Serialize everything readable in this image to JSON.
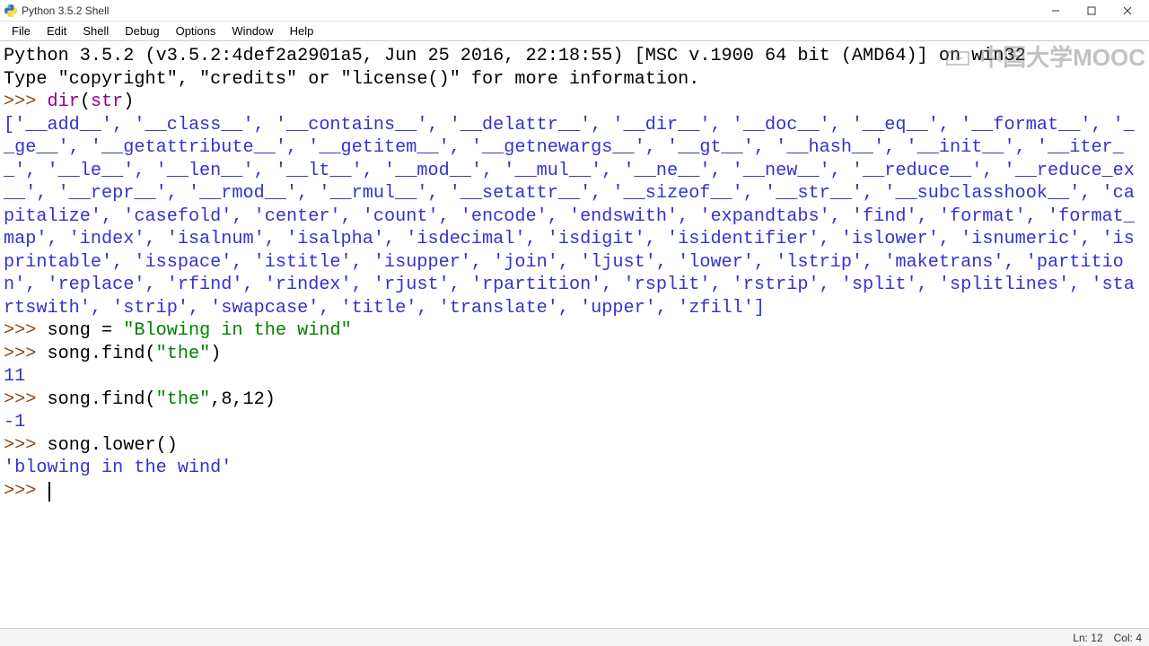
{
  "titlebar": {
    "title": "Python 3.5.2 Shell"
  },
  "menubar": {
    "items": [
      "File",
      "Edit",
      "Shell",
      "Debug",
      "Options",
      "Window",
      "Help"
    ]
  },
  "shell": {
    "banner_line1": "Python 3.5.2 (v3.5.2:4def2a2901a5, Jun 25 2016, 22:18:55) [MSC v.1900 64 bit (AMD64)] on win32",
    "banner_line2": "Type \"copyright\", \"credits\" or \"license()\" for more information.",
    "prompt1_code": "dir(str)",
    "prompt1_builtin": "dir",
    "prompt1_rest": "(",
    "prompt1_arg": "str",
    "prompt1_close": ")",
    "dir_output": "['__add__', '__class__', '__contains__', '__delattr__', '__dir__', '__doc__', '__eq__', '__format__', '__ge__', '__getattribute__', '__getitem__', '__getnewargs__', '__gt__', '__hash__', '__init__', '__iter__', '__le__', '__len__', '__lt__', '__mod__', '__mul__', '__ne__', '__new__', '__reduce__', '__reduce_ex__', '__repr__', '__rmod__', '__rmul__', '__setattr__', '__sizeof__', '__str__', '__subclasshook__', 'capitalize', 'casefold', 'center', 'count', 'encode', 'endswith', 'expandtabs', 'find', 'format', 'format_map', 'index', 'isalnum', 'isalpha', 'isdecimal', 'isdigit', 'isidentifier', 'islower', 'isnumeric', 'isprintable', 'isspace', 'istitle', 'isupper', 'join', 'ljust', 'lower', 'lstrip', 'maketrans', 'partition', 'replace', 'rfind', 'rindex', 'rjust', 'rpartition', 'rsplit', 'rstrip', 'split', 'splitlines', 'startswith', 'strip', 'swapcase', 'title', 'translate', 'upper', 'zfill']",
    "assign_pre": "song = ",
    "assign_str": "\"Blowing in the wind\"",
    "find1_pre": "song.find(",
    "find1_arg": "\"the\"",
    "find1_post": ")",
    "find1_result": "11",
    "find2_pre": "song.find(",
    "find2_arg": "\"the\"",
    "find2_post": ",8,12)",
    "find2_result": "-1",
    "lower_call": "song.lower()",
    "lower_result": "'blowing in the wind'",
    "prompt_symbol": ">>> "
  },
  "statusbar": {
    "ln": "Ln: 12",
    "col": "Col: 4"
  },
  "watermark": {
    "text": "中国大学MOOC"
  }
}
